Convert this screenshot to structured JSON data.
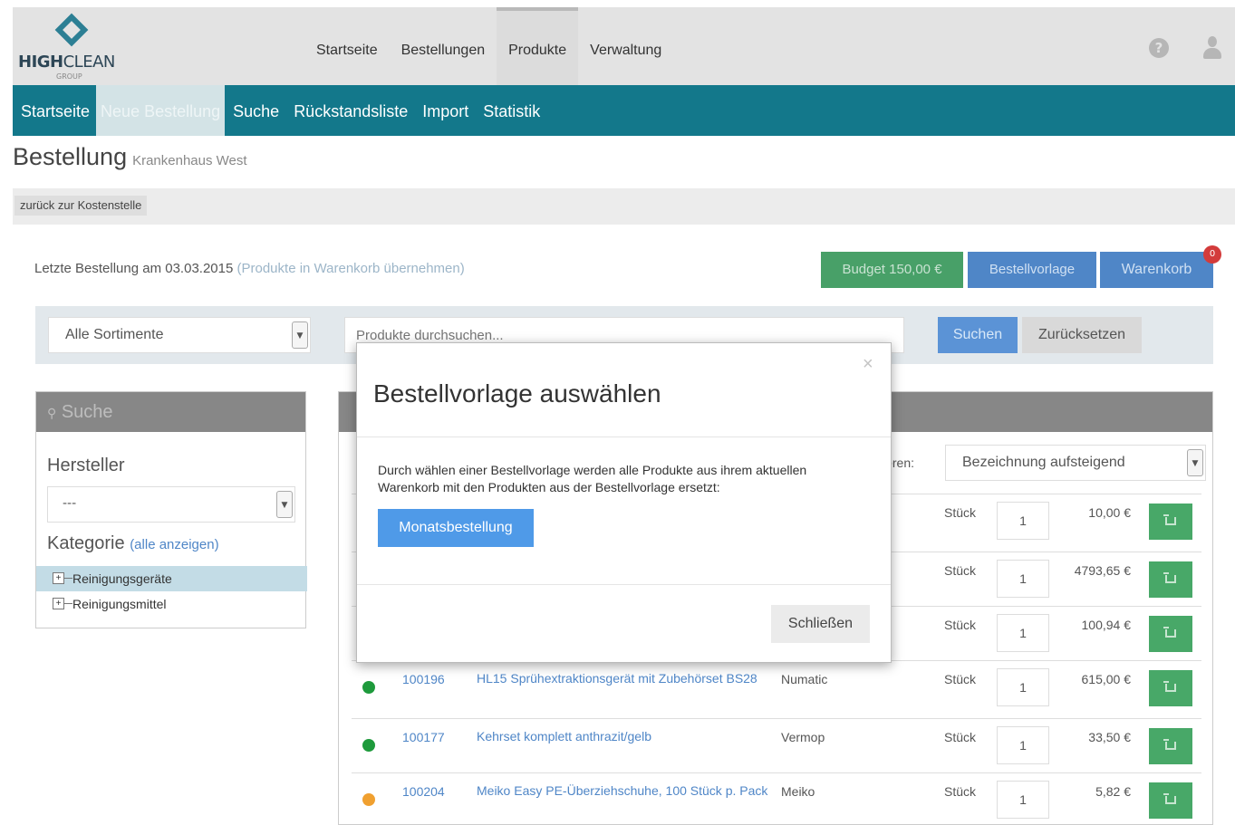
{
  "brand": {
    "logo_bold": "HIGH",
    "logo_rest": "CLEAN",
    "logo_sub": "GROUP"
  },
  "main_nav": [
    "Startseite",
    "Bestellungen",
    "Produkte",
    "Verwaltung"
  ],
  "main_nav_active": "Produkte",
  "sub_nav": [
    "Startseite",
    "Neue Bestellung",
    "Suche",
    "Rückstandsliste",
    "Import",
    "Statistik"
  ],
  "sub_nav_active": "Neue Bestellung",
  "page": {
    "title": "Bestellung",
    "subtitle": "Krankenhaus West",
    "back_label": "zurück zur Kostenstelle",
    "last_order_text": "Letzte Bestellung am 03.03.2015",
    "last_order_link": "(Produkte in Warenkorb übernehmen)"
  },
  "actions": {
    "budget": "Budget 150,00 €",
    "template": "Bestellvorlage",
    "cart": "Warenkorb",
    "cart_count": "0"
  },
  "filter": {
    "assortment": "Alle Sortimente",
    "search_placeholder": "Produkte durchsuchen...",
    "search_button": "Suchen",
    "reset_button": "Zurücksetzen"
  },
  "sidebar": {
    "header": "Suche",
    "manufacturer_label": "Hersteller",
    "manufacturer_value": "---",
    "category_label": "Kategorie",
    "category_show_all": "(alle anzeigen)",
    "categories": [
      "Reinigungsgeräte",
      "Reinigungsmittel"
    ]
  },
  "table": {
    "sort_label": "ieren:",
    "sort_value": "Bezeichnung aufsteigend",
    "rows": [
      {
        "id": "",
        "name": "",
        "manufacturer": "",
        "unit": "Stück",
        "qty": "1",
        "price": "10,00 €",
        "status": "green"
      },
      {
        "id": "",
        "name": "",
        "manufacturer": "",
        "unit": "Stück",
        "qty": "1",
        "price": "4793,65 €",
        "status": "green"
      },
      {
        "id": "",
        "name": "",
        "manufacturer": "",
        "unit": "Stück",
        "qty": "1",
        "price": "100,94 €",
        "status": "green"
      },
      {
        "id": "100196",
        "name": "HL15 Sprühextraktionsgerät mit Zubehörset BS28",
        "manufacturer": "Numatic",
        "unit": "Stück",
        "qty": "1",
        "price": "615,00 €",
        "status": "green"
      },
      {
        "id": "100177",
        "name": "Kehrset komplett anthrazit/gelb",
        "manufacturer": "Vermop",
        "unit": "Stück",
        "qty": "1",
        "price": "33,50 €",
        "status": "green"
      },
      {
        "id": "100204",
        "name": "Meiko Easy PE-Überziehschuhe, 100 Stück p. Pack",
        "manufacturer": "Meiko",
        "unit": "Stück",
        "qty": "1",
        "price": "5,82 €",
        "status": "orange"
      }
    ]
  },
  "modal": {
    "title": "Bestellvorlage auswählen",
    "text": "Durch wählen einer Bestellvorlage werden alle Produkte aus ihrem aktuellen Warenkorb mit den Produkten aus der Bestellvorlage ersetzt:",
    "template_option": "Monatsbestellung",
    "close_button": "Schließen",
    "close_x": "×"
  },
  "colors": {
    "teal": "#13788b",
    "green": "#48a868",
    "blue": "#4f86c7",
    "status_green": "#1e9a3c",
    "status_orange": "#f0a030"
  }
}
